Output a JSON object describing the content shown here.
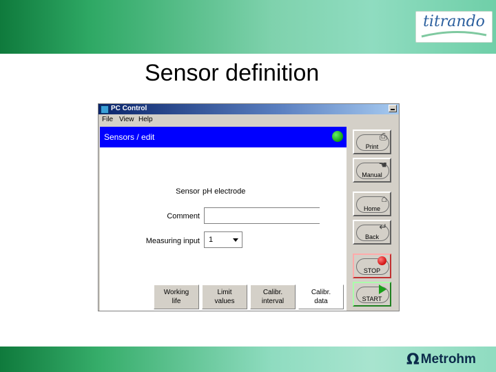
{
  "slide": {
    "title": "Sensor definition",
    "logo_text": "titrando",
    "brand_symbol": "Ω",
    "brand_text": "Metrohm"
  },
  "window": {
    "title": "PC Control",
    "menu": [
      "File",
      "View",
      "Help"
    ],
    "header_title": "Sensors / edit",
    "status_color": "#10a010"
  },
  "form": {
    "sensor_label": "Sensor",
    "sensor_value": "pH electrode",
    "comment_label": "Comment",
    "comment_value": "",
    "measuring_input_label": "Measuring input",
    "measuring_input_value": "1"
  },
  "tabs": [
    {
      "line1": "Working",
      "line2": "life"
    },
    {
      "line1": "Limit",
      "line2": "values"
    },
    {
      "line1": "Calibr.",
      "line2": "interval"
    },
    {
      "line1": "Calibr.",
      "line2": "data"
    }
  ],
  "side_buttons": {
    "print": "Print",
    "manual": "Manual",
    "home": "Home",
    "back": "Back",
    "stop": "STOP",
    "start": "START"
  },
  "colors": {
    "header_blue": "#0000ff",
    "stop_red": "#d01010",
    "start_green": "#1aa01a",
    "banner_green": "#2ea864"
  }
}
